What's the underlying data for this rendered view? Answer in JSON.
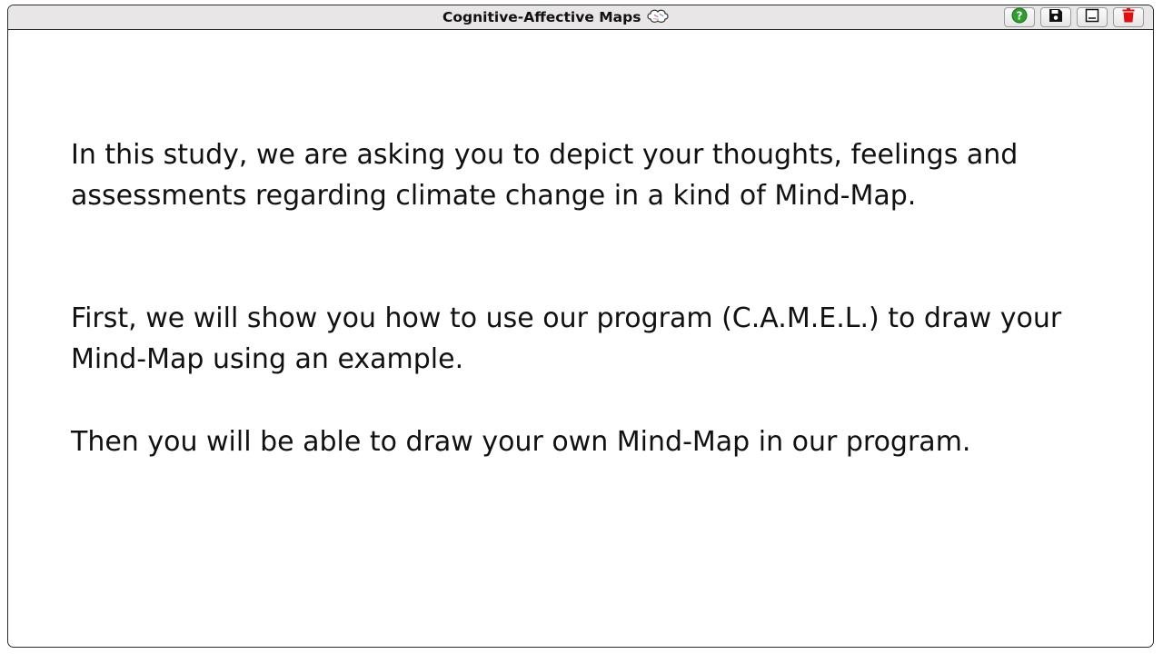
{
  "window": {
    "title": "Cognitive-Affective Maps",
    "title_icon": "brain-icon"
  },
  "toolbar": {
    "buttons": [
      {
        "name": "help",
        "icon": "question-circle-icon",
        "color": "#2e9e2e"
      },
      {
        "name": "save",
        "icon": "floppy-disk-icon",
        "color": "#111111"
      },
      {
        "name": "export-image",
        "icon": "image-icon",
        "color": "#111111"
      },
      {
        "name": "delete",
        "icon": "trash-icon",
        "color": "#e01010"
      }
    ]
  },
  "content": {
    "paragraph1": "In this study, we are asking you to depict your thoughts, feelings and assessments regarding climate change in a kind of Mind-Map.",
    "paragraph2": "First, we will show you how to use our program (C.A.M.E.L.) to draw your Mind-Map using an example.",
    "paragraph3": "Then you will be able to draw your own Mind-Map in our program."
  }
}
